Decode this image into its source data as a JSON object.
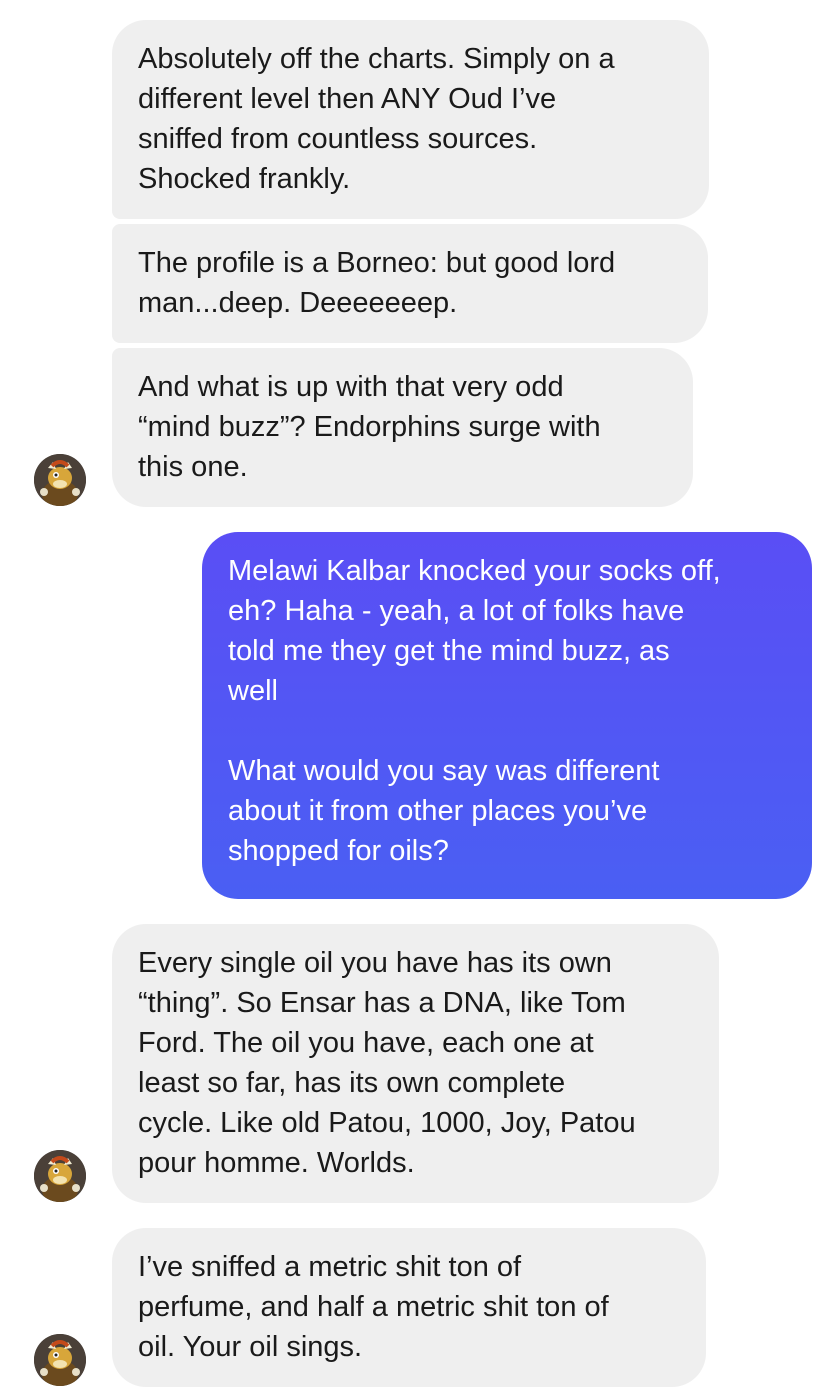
{
  "conversation": {
    "messages": [
      {
        "sender": "them",
        "text": "Absolutely off the charts. Simply on a\ndifferent level then ANY Oud I’ve\nsniffed from countless sources.\nShocked frankly."
      },
      {
        "sender": "them",
        "text": "The profile is a Borneo: but good lord\nman...deep. Deeeeeeep."
      },
      {
        "sender": "them",
        "text": "And what is up with that very odd\n“mind buzz”? Endorphins surge with\nthis one."
      },
      {
        "sender": "me",
        "text": "Melawi Kalbar knocked your socks off,\neh? Haha - yeah, a lot of folks have\ntold me they get the mind buzz, as\nwell\n\nWhat would you say was different\nabout it from other places you’ve\nshopped for oils?"
      },
      {
        "sender": "them",
        "text": "Every single oil you have has its own\n“thing”. So Ensar has a DNA, like Tom\nFord. The oil you have, each one at\nleast so far, has its own complete\ncycle. Like old Patou, 1000, Joy, Patou\npour homme. Worlds."
      },
      {
        "sender": "them",
        "text": "I’ve sniffed a metric shit ton of\nperfume, and half a metric shit ton of\noil. Your oil sings."
      }
    ],
    "avatar_icon": "bowser-figurine-avatar-icon",
    "colors": {
      "incoming_bubble": "#efefef",
      "outgoing_bubble": "#4f55f4",
      "incoming_text": "#1a1a1a",
      "outgoing_text": "#ffffff"
    }
  }
}
